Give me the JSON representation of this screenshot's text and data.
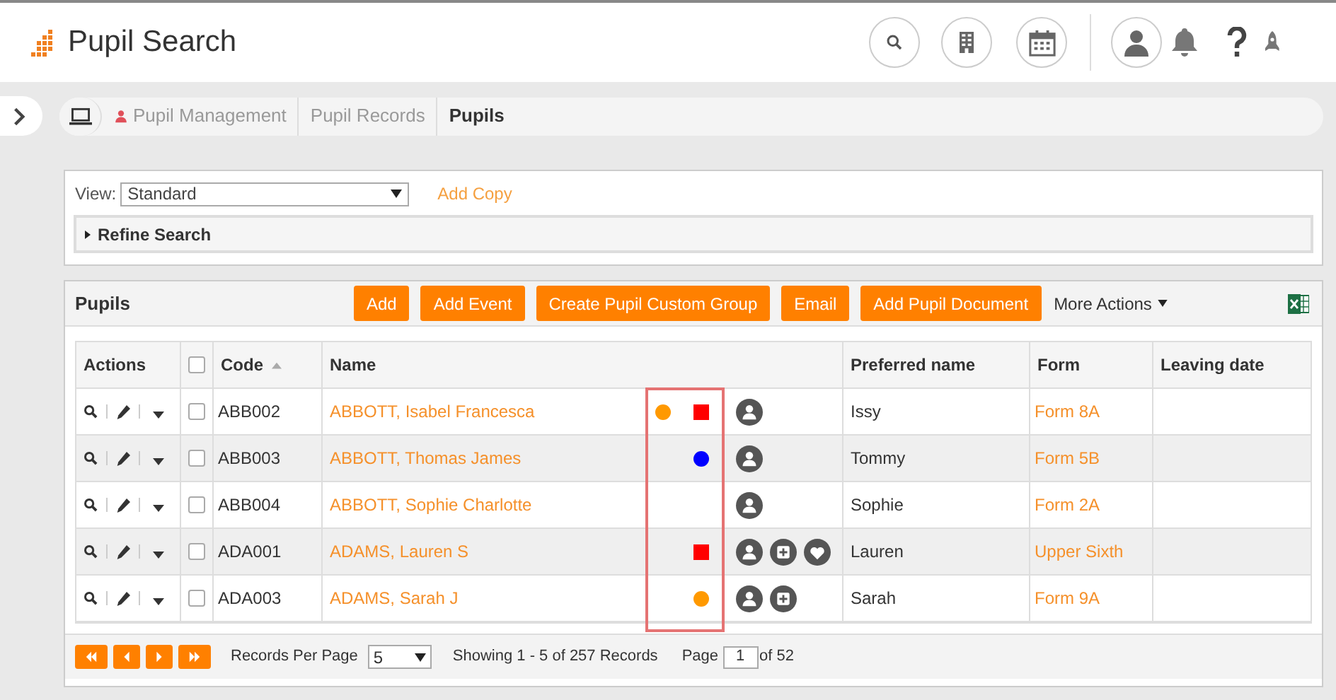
{
  "header": {
    "title": "Pupil Search"
  },
  "breadcrumb": [
    {
      "label": "Pupil Management",
      "kind": "person"
    },
    {
      "label": "Pupil Records",
      "kind": "plain"
    },
    {
      "label": "Pupils",
      "kind": "current"
    }
  ],
  "view": {
    "label": "View:",
    "value": "Standard",
    "link": "Add Copy"
  },
  "refine": {
    "label": "Refine Search",
    "expanded": false
  },
  "panel": {
    "title": "Pupils",
    "buttons": [
      "Add",
      "Add Event",
      "Create Pupil Custom Group",
      "Email",
      "Add Pupil Document"
    ],
    "more": "More Actions"
  },
  "table": {
    "columns": [
      "Actions",
      "Code",
      "Name",
      "Preferred name",
      "Form",
      "Leaving date"
    ],
    "select_all": {
      "checked": false
    },
    "rows": [
      {
        "code": "ABB002",
        "name": "ABBOTT, Isabel Francesca",
        "flag_left": {
          "kind": "dot",
          "color": "#ff9900"
        },
        "flag_right": {
          "kind": "square",
          "color": "#ff0000"
        },
        "icons": [
          {
            "kind": "person"
          }
        ],
        "preferred": "Issy",
        "form": "Form 8A",
        "checked": false
      },
      {
        "code": "ABB003",
        "name": "ABBOTT, Thomas James",
        "flag_right": {
          "kind": "dot",
          "color": "#0000ff"
        },
        "icons": [
          {
            "kind": "person"
          }
        ],
        "preferred": "Tommy",
        "form": "Form 5B",
        "checked": false
      },
      {
        "code": "ABB004",
        "name": "ABBOTT, Sophie Charlotte",
        "icons": [
          {
            "kind": "person"
          }
        ],
        "preferred": "Sophie",
        "form": "Form 2A",
        "checked": false
      },
      {
        "code": "ADA001",
        "name": "ADAMS, Lauren S",
        "flag_right": {
          "kind": "square",
          "color": "#ff0000"
        },
        "icons": [
          {
            "kind": "person"
          },
          {
            "kind": "plus"
          },
          {
            "kind": "heart"
          }
        ],
        "preferred": "Lauren",
        "form": "Upper Sixth",
        "checked": false
      },
      {
        "code": "ADA003",
        "name": "ADAMS, Sarah J",
        "flag_right": {
          "kind": "dot",
          "color": "#ff9900"
        },
        "icons": [
          {
            "kind": "person"
          },
          {
            "kind": "plus"
          }
        ],
        "preferred": "Sarah",
        "form": "Form 9A",
        "checked": false
      }
    ]
  },
  "pager": {
    "per_page_label": "Records Per Page",
    "per_page": "5",
    "showing": "Showing 1 - 5 of 257 Records",
    "page_label": "Page",
    "page": "1",
    "of": "of 52"
  }
}
